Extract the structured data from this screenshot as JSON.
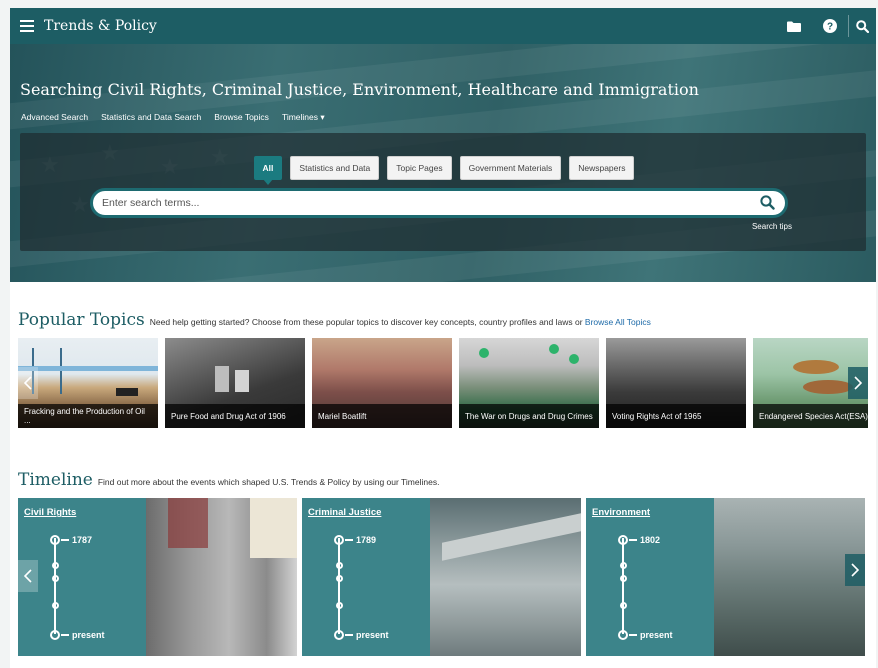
{
  "topbar": {
    "title": "Trends & Policy",
    "icons": [
      "menu-icon",
      "folder-icon",
      "help-icon",
      "search-icon"
    ]
  },
  "hero": {
    "title": "Searching Civil Rights, Criminal Justice, Environment, Healthcare and Immigration",
    "links": {
      "advanced": "Advanced Search",
      "statistics": "Statistics and Data Search",
      "topics": "Browse Topics",
      "timelines": "Timelines ▾"
    },
    "filters": {
      "all": "All",
      "stats": "Statistics and Data",
      "topic_pages": "Topic Pages",
      "government": "Government Materials",
      "newspapers": "Newspapers"
    },
    "search_placeholder": "Enter search terms...",
    "search_tips": "Search tips"
  },
  "popular": {
    "title": "Popular Topics",
    "subtitle": "Need help getting started? Choose from these popular topics to discover key concepts, country profiles and laws or",
    "browse_link": "Browse All Topics",
    "cards": [
      {
        "label": "Fracking and the Production of Oil ..."
      },
      {
        "label": "Pure Food and Drug Act of 1906"
      },
      {
        "label": "Mariel Boatlift"
      },
      {
        "label": "The War on Drugs and Drug Crimes"
      },
      {
        "label": "Voting Rights Act of 1965"
      },
      {
        "label": "Endangered Species Act(ESA)"
      }
    ]
  },
  "timeline": {
    "title": "Timeline",
    "subtitle": "Find out more about the events which shaped U.S. Trends & Policy by using our Timelines.",
    "items": [
      {
        "title": "Civil Rights",
        "start": "1787",
        "end": "present"
      },
      {
        "title": "Criminal Justice",
        "start": "1789",
        "end": "present"
      },
      {
        "title": "Environment",
        "start": "1802",
        "end": "present"
      }
    ]
  },
  "colors": {
    "brand": "#1d5d64",
    "accent": "#1b7b80",
    "link": "#1d6aa8"
  }
}
